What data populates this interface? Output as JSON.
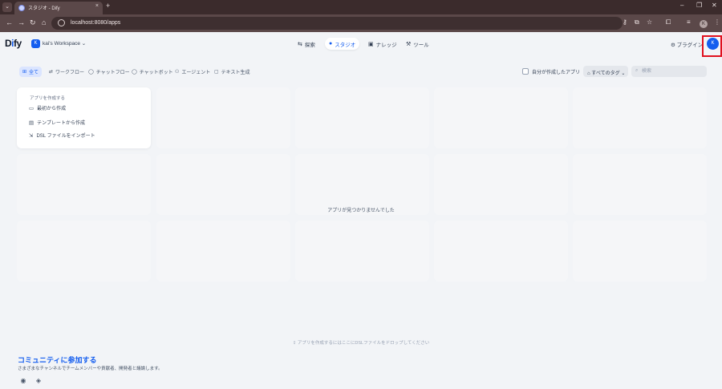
{
  "browser": {
    "tab_title": "スタジオ - Dify",
    "tab_close": "×",
    "new_tab": "+",
    "url": "localhost:8080/apps",
    "profile_initial": "K",
    "icons": [
      "back-icon",
      "forward-icon",
      "reload-icon",
      "home-icon",
      "site-info-icon",
      "password-key-icon",
      "install-app-icon",
      "bookmark-star-icon",
      "extensions-icon",
      "media-icon",
      "kebab-menu-icon"
    ],
    "window_controls": [
      "minimize",
      "restore",
      "close"
    ]
  },
  "app": {
    "logo_text_a": "D",
    "logo_text_i": "i",
    "logo_text_b": "fy",
    "workspace_initial": "K",
    "workspace_name": "kai's Workspace ⌄",
    "nav": [
      {
        "label": "探索",
        "icon": "explore-icon",
        "active": false
      },
      {
        "label": "スタジオ",
        "icon": "studio-icon",
        "active": true
      },
      {
        "label": "ナレッジ",
        "icon": "knowledge-icon",
        "active": false
      },
      {
        "label": "ツール",
        "icon": "tools-icon",
        "active": false
      }
    ],
    "plugin_label": "プラグイン",
    "user_initial": "K"
  },
  "filters": {
    "tabs": [
      {
        "label": "全て",
        "active": true
      },
      {
        "label": "ワークフロー",
        "active": false
      },
      {
        "label": "チャットフロー",
        "active": false
      },
      {
        "label": "チャットボット",
        "active": false
      },
      {
        "label": "エージェント",
        "active": false
      },
      {
        "label": "テキスト生成",
        "active": false
      }
    ],
    "created_by_me": "自分が作成したアプリ",
    "tag_select": "すべてのタグ",
    "search_placeholder": "検索"
  },
  "create_card": {
    "title": "アプリを作成する",
    "items": [
      "最初から作成",
      "テンプレートから作成",
      "DSL ファイルをインポート"
    ]
  },
  "empty_message": "アプリが見つかりませんでした",
  "drop_hint": "アプリを作成するにはここにDSLファイルをドロップしてください",
  "community": {
    "title": "コミュニティに参加する",
    "subtitle": "さまざまなチャンネルでチームメンバーや貢献者、開発者と議論します。",
    "icons": [
      "github-icon",
      "discord-icon"
    ]
  }
}
